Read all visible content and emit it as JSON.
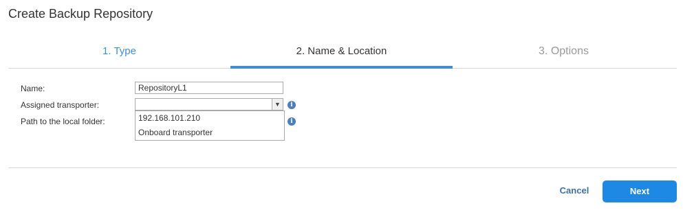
{
  "dialog": {
    "title": "Create Backup Repository"
  },
  "tabs": [
    {
      "label": "1. Type",
      "state": "completed"
    },
    {
      "label": "2. Name & Location",
      "state": "active"
    },
    {
      "label": "3. Options",
      "state": "upcoming"
    }
  ],
  "form": {
    "name": {
      "label": "Name:",
      "value": "RepositoryL1"
    },
    "assigned_transporter": {
      "label": "Assigned transporter:",
      "value": "",
      "options": [
        "192.168.101.210",
        "Onboard transporter"
      ]
    },
    "path": {
      "label": "Path to the local folder:"
    }
  },
  "footer": {
    "cancel_label": "Cancel",
    "next_label": "Next"
  },
  "colors": {
    "accent": "#3b8fd9",
    "primary_button": "#1e88e5",
    "info_icon": "#4a7ebf"
  }
}
